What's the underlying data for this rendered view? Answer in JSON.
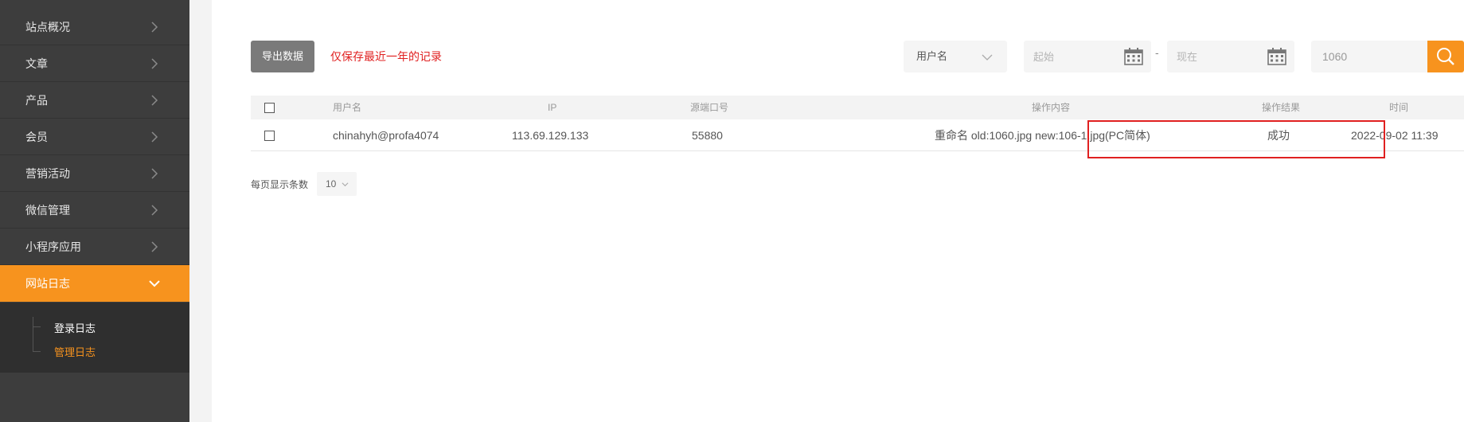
{
  "sidebar": {
    "items": [
      {
        "label": "站点概况"
      },
      {
        "label": "文章"
      },
      {
        "label": "产品"
      },
      {
        "label": "会员"
      },
      {
        "label": "营销活动"
      },
      {
        "label": "微信管理"
      },
      {
        "label": "小程序应用"
      },
      {
        "label": "网站日志",
        "active": true
      }
    ],
    "submenu": [
      {
        "label": "登录日志"
      },
      {
        "label": "管理日志",
        "current": true
      }
    ]
  },
  "toolbar": {
    "export_label": "导出数据",
    "notice": "仅保存最近一年的记录",
    "filter_selected": "用户名",
    "date_start_placeholder": "起始",
    "date_separator": "-",
    "date_end_placeholder": "现在",
    "search_value": "1060"
  },
  "table": {
    "headers": {
      "username": "用户名",
      "ip": "IP",
      "port": "源端口号",
      "content": "操作内容",
      "result": "操作结果",
      "time": "时间"
    },
    "rows": [
      {
        "username": "chinahyh@profa4074",
        "ip": "113.69.129.133",
        "port": "55880",
        "content": "重命名 old:1060.jpg new:106-1.jpg(PC简体)",
        "result": "成功",
        "time": "2022-09-02 11:39"
      }
    ]
  },
  "pager": {
    "label": "每页显示条数",
    "page_size": "10"
  },
  "colors": {
    "accent": "#f7931e",
    "sidebar_bg": "#3d3d3d",
    "highlight": "#e02020"
  }
}
